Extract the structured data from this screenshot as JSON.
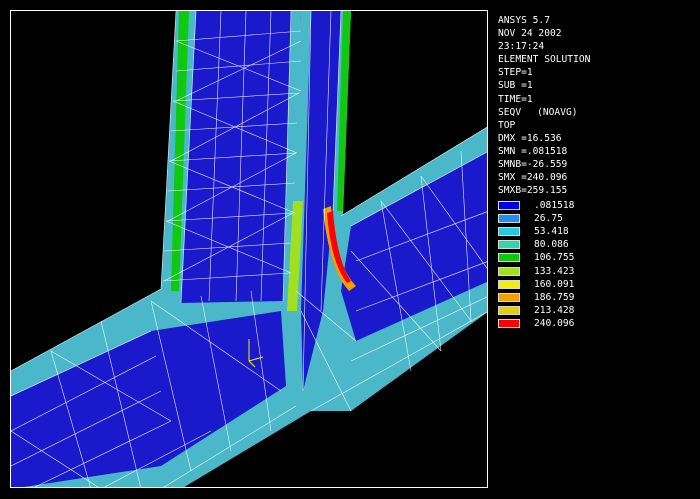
{
  "app": {
    "name": "ANSYS 5.7"
  },
  "info": {
    "date": "NOV 24 2002",
    "time": "23:17:24",
    "mode": "ELEMENT SOLUTION",
    "step": "STEP=1",
    "sub": "SUB =1",
    "time_val": "TIME=1",
    "item": "SEQV",
    "avg": "(NOAVG)",
    "layer": "TOP",
    "dmx": "DMX =16.536",
    "smn": "SMN =.081518",
    "smnb": "SMNB=-26.559",
    "smx": "SMX =240.096",
    "smxb": "SMXB=259.155"
  },
  "legend": [
    {
      "label": ".081518",
      "color": "#0000e6"
    },
    {
      "label": "26.75",
      "color": "#1e8ef0"
    },
    {
      "label": "53.418",
      "color": "#28c8e0"
    },
    {
      "label": "80.086",
      "color": "#2ad8b0"
    },
    {
      "label": "106.755",
      "color": "#10c810"
    },
    {
      "label": "133.423",
      "color": "#a0e020"
    },
    {
      "label": "160.091",
      "color": "#f0f000"
    },
    {
      "label": "186.759",
      "color": "#f0a000"
    },
    {
      "label": "213.428",
      "color": "#e0d000"
    },
    {
      "label": "240.096",
      "color": "#ff0000"
    }
  ],
  "colors": {
    "background": "#000000",
    "low_stress": "#1a1acc",
    "mid_stress": "#4ab8c8",
    "high_stress": "#ff0000",
    "mesh_lines": "#ffffff"
  }
}
